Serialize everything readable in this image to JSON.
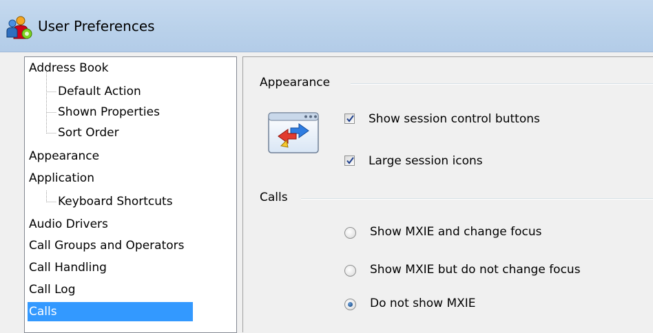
{
  "window": {
    "title": "User Preferences",
    "app_icon": "user-preferences-app-icon"
  },
  "tree": {
    "items": [
      {
        "label": "Address Book",
        "level": 0
      },
      {
        "label": "Default Action",
        "level": 1
      },
      {
        "label": "Shown Properties",
        "level": 1
      },
      {
        "label": "Sort Order",
        "level": 1
      },
      {
        "label": "Appearance",
        "level": 0
      },
      {
        "label": "Application",
        "level": 0
      },
      {
        "label": "Keyboard Shortcuts",
        "level": 1
      },
      {
        "label": "Audio Drivers",
        "level": 0
      },
      {
        "label": "Call Groups and Operators",
        "level": 0
      },
      {
        "label": "Call Handling",
        "level": 0
      },
      {
        "label": "Call Log",
        "level": 0
      },
      {
        "label": "Calls",
        "level": 0,
        "selected": true
      }
    ],
    "selection_color": "#3399ff"
  },
  "content": {
    "appearance_group": {
      "label": "Appearance",
      "icon": "session-control-icon",
      "options": [
        {
          "label": "Show session control buttons",
          "checked": true
        },
        {
          "label": "Large session icons",
          "checked": true
        }
      ]
    },
    "calls_group": {
      "label": "Calls",
      "options": [
        {
          "label": "Show MXIE and change focus",
          "selected": false
        },
        {
          "label": "Show MXIE but do not change focus",
          "selected": false
        },
        {
          "label": "Do not show MXIE",
          "selected": true
        }
      ]
    }
  }
}
